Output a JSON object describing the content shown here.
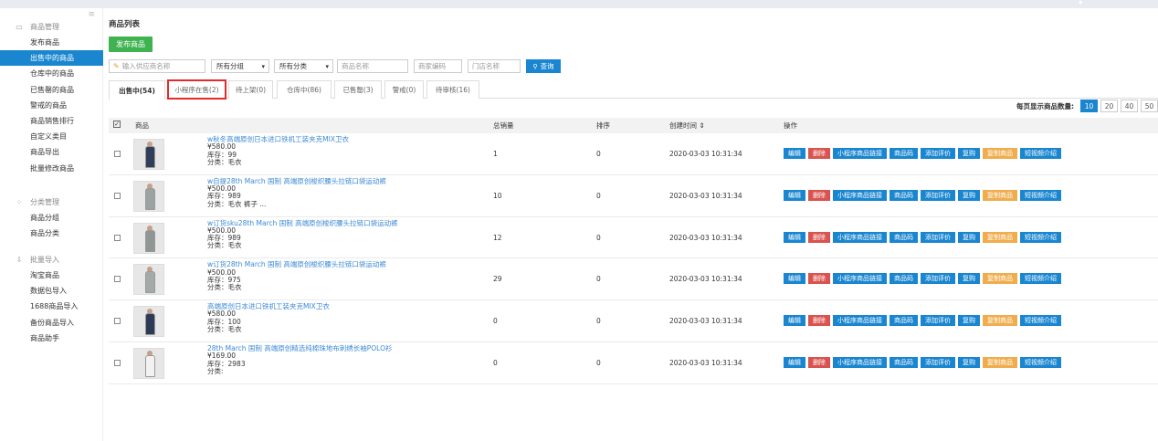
{
  "sidebar": {
    "groups": [
      {
        "head": "商品管理",
        "icon": "goods-icon",
        "items": [
          "发布商品",
          "出售中的商品",
          "仓库中的商品",
          "已售罄的商品",
          "警戒的商品",
          "商品销售排行",
          "自定义类目",
          "商品导出",
          "批量修改商品"
        ]
      },
      {
        "head": "分类管理",
        "icon": "category-icon",
        "items": [
          "商品分组",
          "商品分类"
        ]
      },
      {
        "head": "批量导入",
        "icon": "import-icon",
        "items": [
          "淘宝商品",
          "数据包导入",
          "1688商品导入",
          "备份商品导入",
          "商品助手"
        ]
      }
    ],
    "active": "出售中的商品"
  },
  "main": {
    "title": "商品列表",
    "publish_button": "发布商品",
    "filters": {
      "supplier_placeholder": "输入供应商名称",
      "group_select": "所有分组",
      "category_select": "所有分类",
      "name_placeholder": "商品名称",
      "code_placeholder": "商家编码",
      "store_placeholder": "门店名称",
      "search_button": "查询"
    },
    "tabs": [
      "出售中(54)",
      "小程序在售(2)",
      "待上架(0)",
      "仓库中(86)",
      "已售罄(3)",
      "警戒(0)",
      "待审核(16)"
    ],
    "pager": {
      "label": "每页显示商品数量:",
      "options": [
        "10",
        "20",
        "40",
        "50"
      ],
      "selected": "10"
    },
    "table": {
      "headers": {
        "product": "商品",
        "sales": "总销量",
        "sort": "排序",
        "created": "创建时间",
        "created_sort_icon": "⇕",
        "ops": "操作"
      },
      "rows": [
        {
          "title": "w秋冬高端原创日本进口铁机工装夹克MIX卫衣",
          "price": "¥580.00",
          "stock": "库存：99",
          "cat": "分类：毛衣",
          "sales": "1",
          "sort": "0",
          "created": "2020-03-03 10:31:34"
        },
        {
          "title": "w自提28th March 国制 高端原创梭织腰头拉链口袋运动裤",
          "price": "¥500.00",
          "stock": "库存：989",
          "cat": "分类：毛衣 裤子 ...",
          "sales": "10",
          "sort": "0",
          "created": "2020-03-03 10:31:34"
        },
        {
          "title": "w订货sku28th March 国制 高端原创梭织腰头拉链口袋运动裤",
          "price": "¥500.00",
          "stock": "库存：989",
          "cat": "分类：毛衣",
          "sales": "12",
          "sort": "0",
          "created": "2020-03-03 10:31:34"
        },
        {
          "title": "w订货28th March 国制 高端原创梭织腰头拉链口袋运动裤",
          "price": "¥500.00",
          "stock": "库存：975",
          "cat": "分类：毛衣",
          "sales": "29",
          "sort": "0",
          "created": "2020-03-03 10:31:34"
        },
        {
          "title": "高端原创日本进口铁机工装夹克MIX卫衣",
          "price": "¥580.00",
          "stock": "库存：100",
          "cat": "分类：毛衣",
          "sales": "0",
          "sort": "0",
          "created": "2020-03-03 10:31:34"
        },
        {
          "title": "28th March 国制 高端原创精选纯棉珠地布刺绣长袖POLO衫",
          "price": "¥169.00",
          "stock": "库存：2983",
          "cat": "分类:",
          "sales": "0",
          "sort": "0",
          "created": "2020-03-03 10:31:34"
        }
      ],
      "ops": [
        {
          "label": "编辑",
          "color": "#1a86d0"
        },
        {
          "label": "删除",
          "color": "#d9534f"
        },
        {
          "label": "小程序商品链接",
          "color": "#1a86d0"
        },
        {
          "label": "商品码",
          "color": "#1a86d0"
        },
        {
          "label": "添加评价",
          "color": "#1a86d0"
        },
        {
          "label": "复购",
          "color": "#1a86d0"
        },
        {
          "label": "复制商品",
          "color": "#f0ad4e"
        },
        {
          "label": "短视频介绍",
          "color": "#1a86d0"
        }
      ]
    }
  }
}
